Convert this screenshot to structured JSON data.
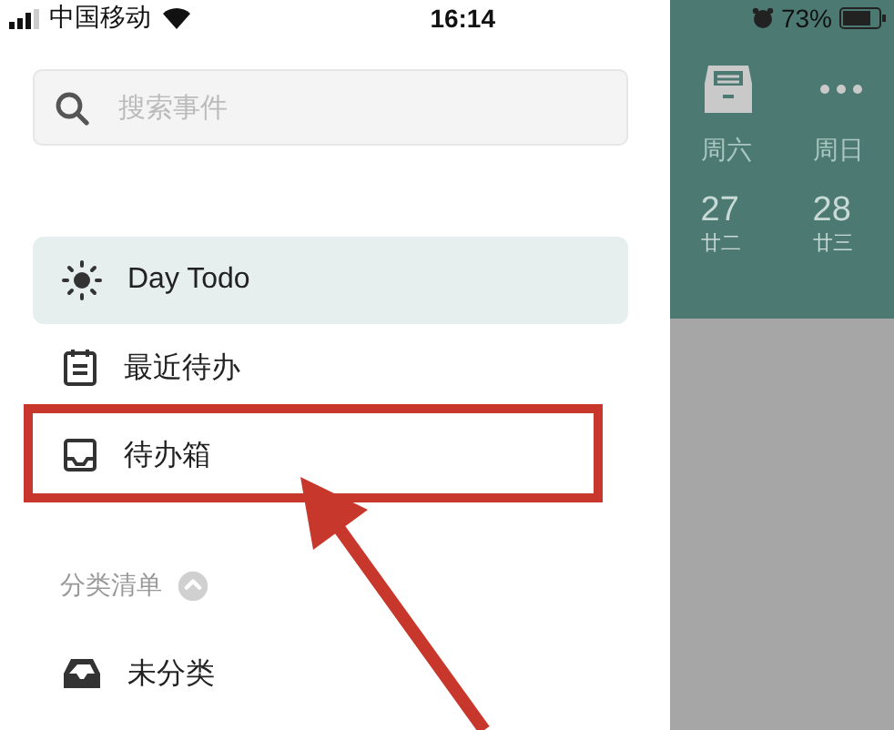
{
  "status_bar": {
    "carrier": "中国移动",
    "time": "16:14",
    "battery": "73%"
  },
  "drawer": {
    "search": {
      "placeholder": "搜索事件"
    },
    "items": [
      {
        "label": "Day Todo",
        "selected": true,
        "highlighted": false
      },
      {
        "label": "最近待办",
        "selected": false,
        "highlighted": false
      },
      {
        "label": "待办箱",
        "selected": false,
        "highlighted": true
      }
    ],
    "section": {
      "title": "分类清单",
      "expanded": true
    },
    "lists": [
      {
        "label": "未分类",
        "selected": false
      }
    ]
  },
  "background_app": {
    "days": [
      {
        "weekday": "周六",
        "date": "27",
        "lunar": "廿二"
      },
      {
        "weekday": "周日",
        "date": "28",
        "lunar": "廿三"
      }
    ]
  }
}
